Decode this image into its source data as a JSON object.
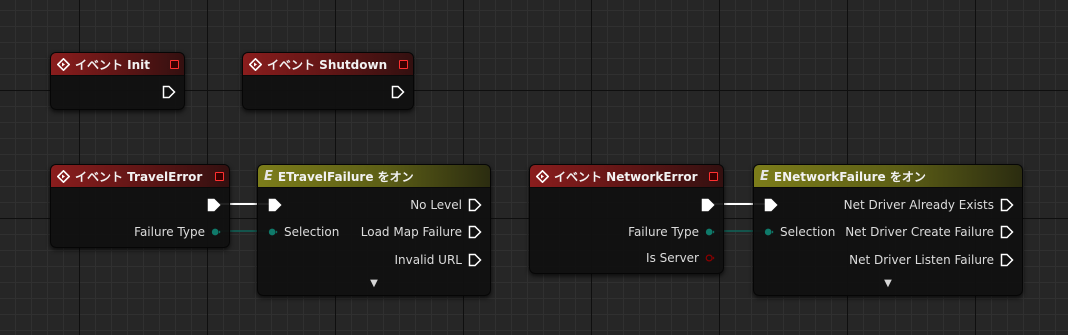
{
  "nodes": {
    "init": {
      "title": "イベント Init"
    },
    "shutdown": {
      "title": "イベント Shutdown"
    },
    "travel_error": {
      "title": "イベント TravelError",
      "pin_failure_type": "Failure Type"
    },
    "travel_switch": {
      "title": "ETravelFailure をオン",
      "pin_selection": "Selection",
      "outputs": [
        "No Level",
        "Load Map Failure",
        "Invalid URL"
      ]
    },
    "network_error": {
      "title": "イベント NetworkError",
      "pin_failure_type": "Failure Type",
      "pin_is_server": "Is Server"
    },
    "network_switch": {
      "title": "ENetworkFailure をオン",
      "pin_selection": "Selection",
      "outputs": [
        "Net Driver Already Exists",
        "Net Driver Create Failure",
        "Net Driver Listen Failure"
      ]
    }
  },
  "colors": {
    "event_header": "#8a1d1d",
    "switch_header": "#7c7d1a",
    "enum_pin": "#0f7a6a",
    "bool_pin": "#8c0000",
    "delegate_pin": "#ff3030"
  },
  "icons": {
    "event": "diamond-event-icon",
    "switch": "switch-enum-icon",
    "exec": "exec-pin-icon",
    "expand": "chevron-down-icon"
  }
}
